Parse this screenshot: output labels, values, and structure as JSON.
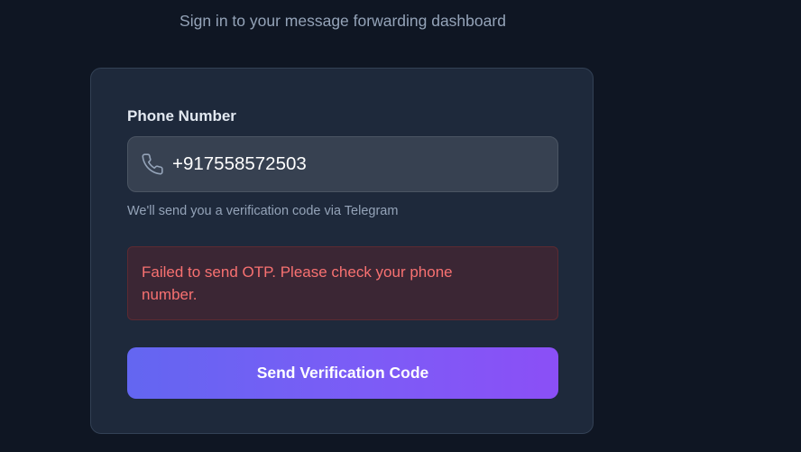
{
  "header": {
    "subtitle": "Sign in to your message forwarding dashboard"
  },
  "form": {
    "phone_label": "Phone Number",
    "phone_value": "+917558572503",
    "phone_icon": "phone-icon",
    "hint": "We'll send you a verification code via Telegram",
    "error_message": "Failed to send OTP. Please check your phone number.",
    "submit_label": "Send Verification Code"
  },
  "colors": {
    "background": "#0f1623",
    "card": "#1e293b",
    "error_text": "#f87171",
    "button_gradient_start": "#6366f1",
    "button_gradient_end": "#8b4ff6"
  }
}
